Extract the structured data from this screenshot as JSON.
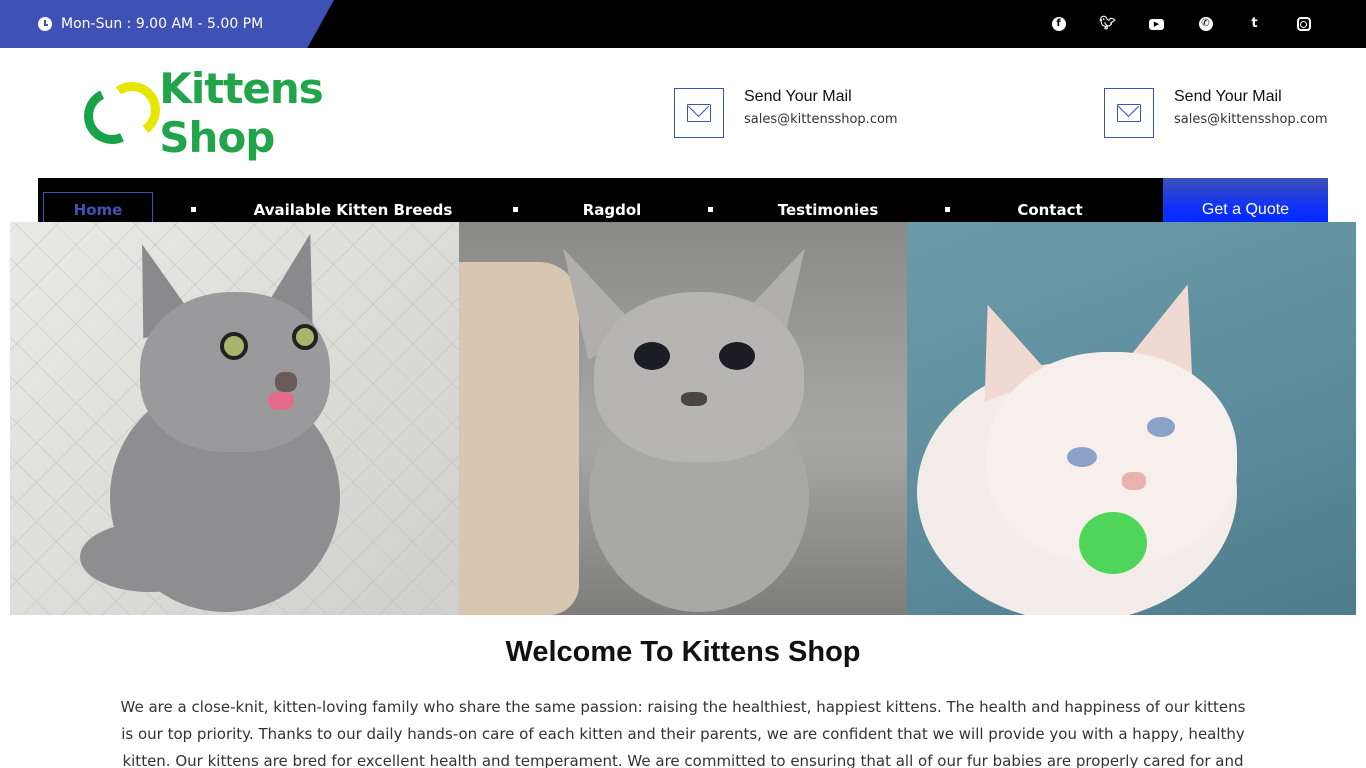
{
  "topbar": {
    "hours": "Mon-Sun : 9.00 AM - 5.00 PM",
    "hours_bg": "#3f51b5",
    "socials": [
      {
        "name": "facebook-icon"
      },
      {
        "name": "twitter-icon"
      },
      {
        "name": "youtube-icon"
      },
      {
        "name": "whatsapp-icon"
      },
      {
        "name": "tumblr-icon"
      },
      {
        "name": "instagram-icon"
      }
    ]
  },
  "header": {
    "logo_text": "Kittens Shop",
    "contacts": [
      {
        "title": "Send Your Mail",
        "email": "sales@kittensshop.com",
        "icon": "envelope-icon"
      },
      {
        "title": "Send Your Mail",
        "email": "sales@kittensshop.com",
        "icon": "envelope-icon"
      }
    ]
  },
  "nav": {
    "items": [
      {
        "label": "Home",
        "active": true
      },
      {
        "label": "Available Kitten Breeds"
      },
      {
        "label": "Ragdol"
      },
      {
        "label": "Testimonies"
      },
      {
        "label": "Contact"
      }
    ],
    "cta": "Get a Quote",
    "accent": "#0a2fff"
  },
  "gallery": {
    "photos": [
      {
        "subject": "grey kitten on quilted white blanket"
      },
      {
        "subject": "grey kitten on grey couch"
      },
      {
        "subject": "white fluffy kitten with green ball on teal couch"
      }
    ]
  },
  "welcome": {
    "title": "Welcome To Kittens Shop",
    "body": "We are a close-knit, kitten-loving family who share the same passion: raising the healthiest, happiest kittens. The health and happiness of our kittens is our top priority. Thanks to our daily hands-on care of each kitten and their parents, we are confident that we will provide you with a happy, healthy kitten. Our kittens are bred for excellent health and temperament. We are committed to ensuring that all of our fur babies are properly cared for and treated"
  }
}
